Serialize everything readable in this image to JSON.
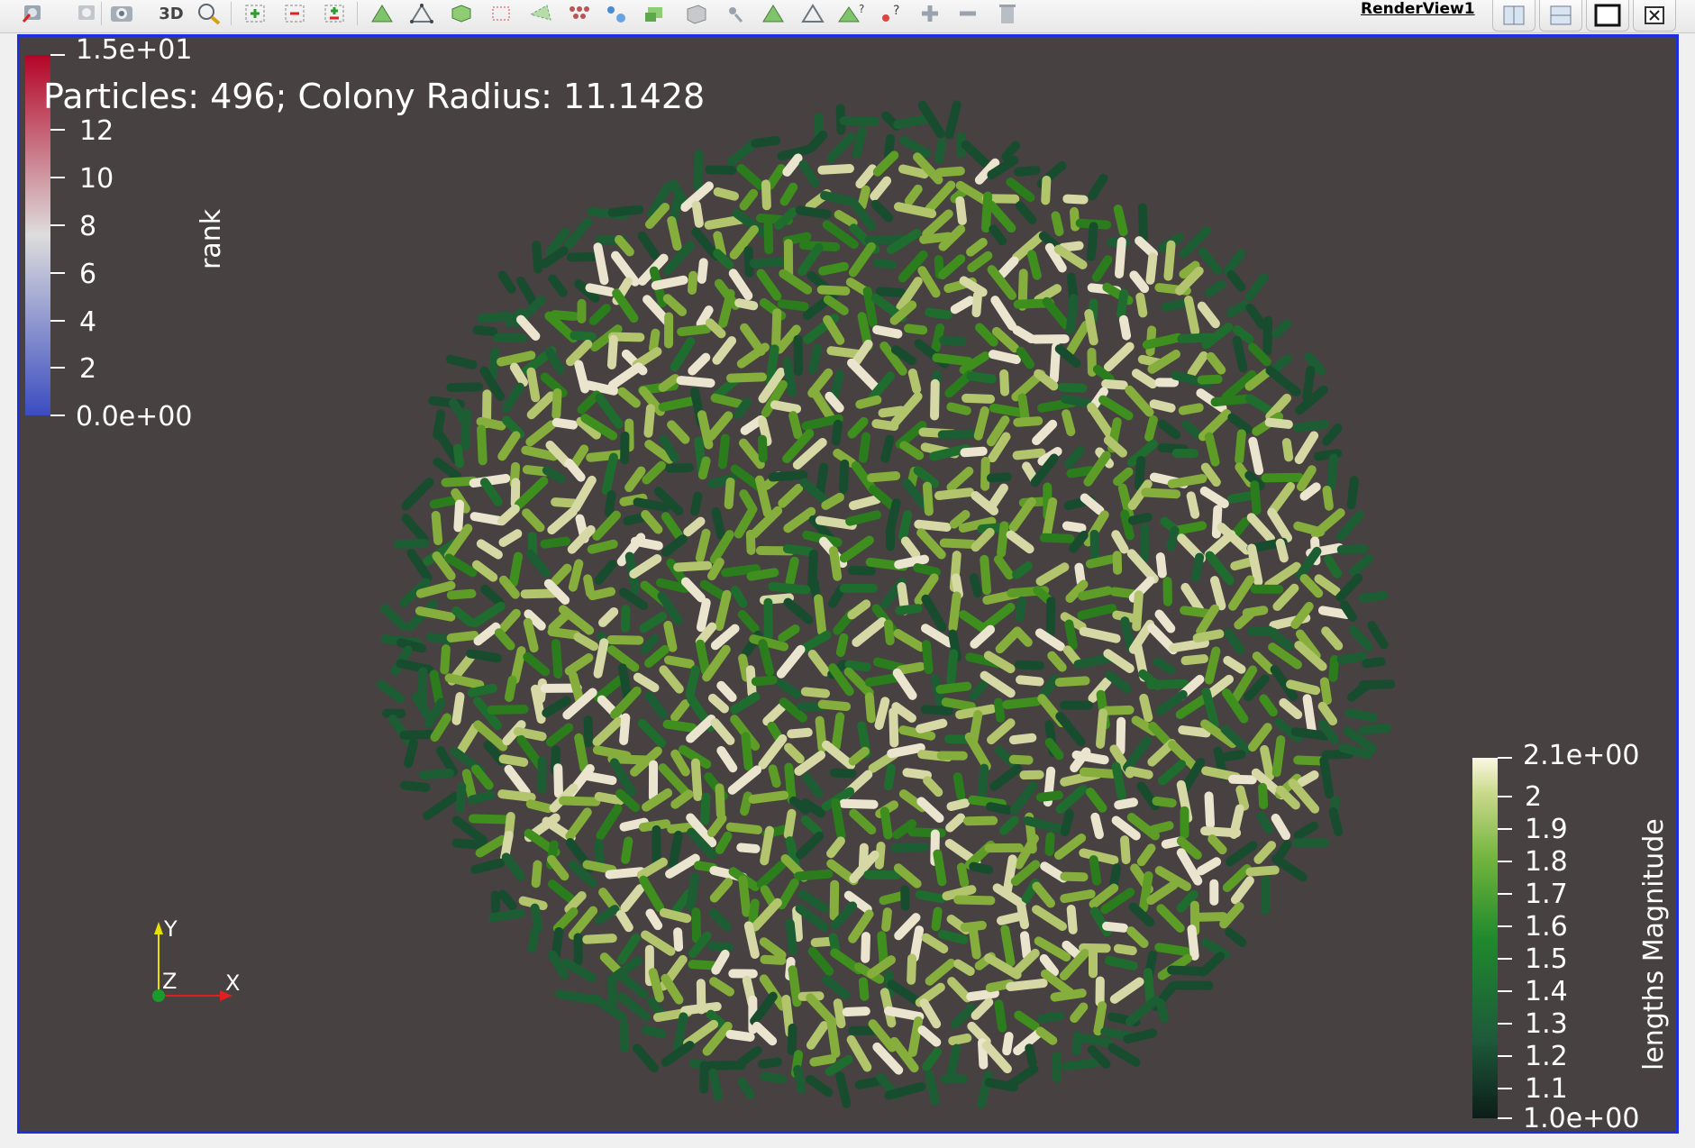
{
  "toolbar": {
    "mode_label": "3D",
    "view_name": "RenderView1",
    "icons": [
      "reset-camera-icon",
      "undo-camera-icon",
      "capture-screenshot-icon",
      "zoom-to-box-icon",
      "add-selection-icon",
      "subtract-selection-icon",
      "toggle-selection-icon",
      "select-cells-on-icon",
      "select-points-on-icon",
      "select-cells-frustum-icon",
      "select-points-frustum-icon",
      "select-polygon-icon",
      "select-blocks-icon",
      "interactive-select-icon",
      "hover-points-icon",
      "hover-cells-icon",
      "grow-selection-icon",
      "shrink-selection-icon",
      "clear-selection-icon"
    ],
    "window_buttons": [
      "split-horizontal-icon",
      "split-vertical-icon",
      "maximize-icon",
      "close-icon"
    ]
  },
  "viewport": {
    "annotation": "Particles: 496; Colony Radius: 11.1428",
    "background": "#474141",
    "border_color": "#1d2fe0"
  },
  "legend_rank": {
    "title": "rank",
    "max_label": "1.5e+01",
    "min_label": "0.0e+00",
    "ticks": [
      "12",
      "10",
      "8",
      "6",
      "4",
      "2"
    ],
    "colors": [
      "#3b4cc0",
      "#dddddd",
      "#b40426"
    ]
  },
  "legend_lengths": {
    "title": "lengths Magnitude",
    "max_label": "2.1e+00",
    "min_label": "1.0e+00",
    "ticks": [
      "2",
      "1.9",
      "1.8",
      "1.7",
      "1.6",
      "1.5",
      "1.4",
      "1.3",
      "1.2",
      "1.1"
    ],
    "colors": [
      "#0c1d19",
      "#1e5a3a",
      "#1f8a2d",
      "#72b43c",
      "#c8d98a",
      "#fbf8e2"
    ]
  },
  "axes": {
    "y_label": "Y",
    "x_label": "X",
    "z_label": "Z"
  },
  "colony": {
    "particle_palette": [
      "#174d2e",
      "#1d5d34",
      "#1f6c2f",
      "#2a7c1d",
      "#3f8f1f",
      "#5d9c27",
      "#86ae3c",
      "#b2c46c",
      "#d6d9a6",
      "#ebe5d0"
    ]
  }
}
